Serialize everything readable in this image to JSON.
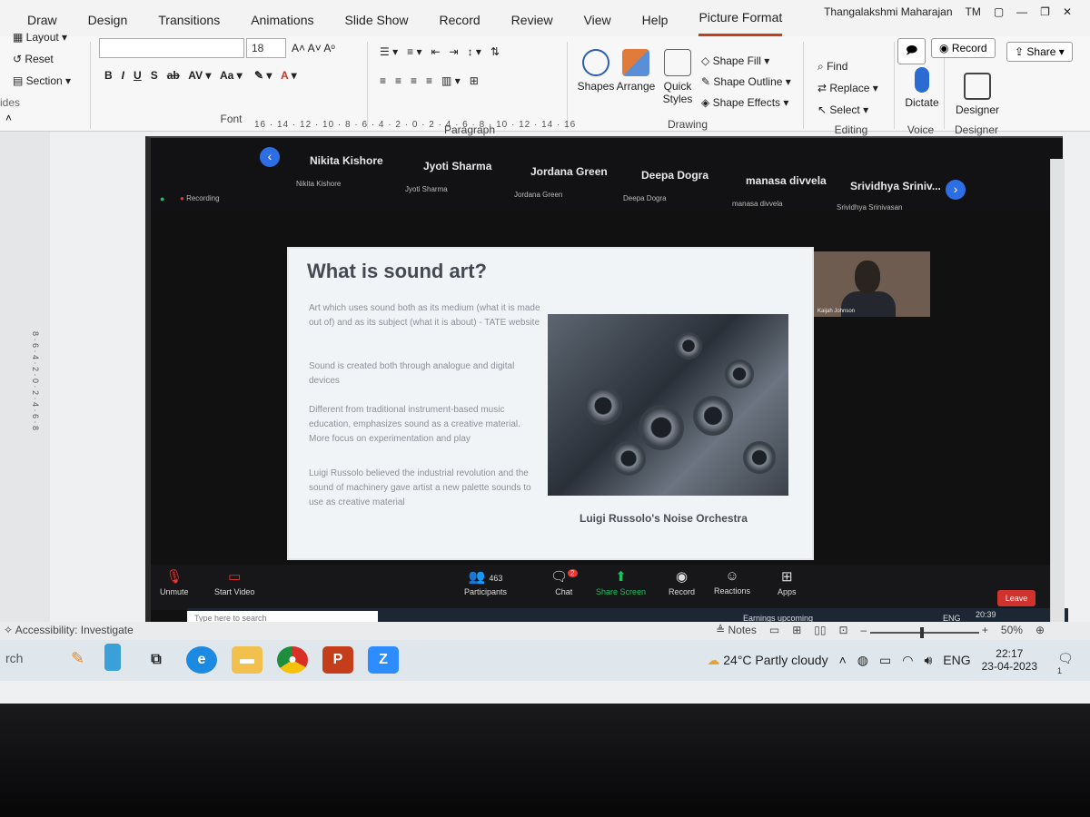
{
  "ribbon": {
    "tabs": [
      "Draw",
      "Design",
      "Transitions",
      "Animations",
      "Slide Show",
      "Record",
      "Review",
      "View",
      "Help",
      "Picture Format"
    ],
    "user_name": "Thangalakshmi Maharajan",
    "user_initials": "TM",
    "record_button": "Record",
    "share_button": "Share",
    "slides": {
      "layout": "Layout",
      "reset": "Reset",
      "section": "Section",
      "label": "ides"
    },
    "font": {
      "size": "18",
      "label": "Font"
    },
    "paragraph_label": "Paragraph",
    "drawing": {
      "shapes": "Shapes",
      "arrange": "Arrange",
      "quick_styles": "Quick Styles",
      "shape_fill": "Shape Fill",
      "shape_outline": "Shape Outline",
      "shape_effects": "Shape Effects",
      "label": "Drawing"
    },
    "editing": {
      "find": "Find",
      "replace": "Replace",
      "select": "Select",
      "label": "Editing"
    },
    "voice": {
      "dictate": "Dictate",
      "label": "Voice"
    },
    "designer": {
      "button": "Designer",
      "label": "Designer"
    },
    "ruler_text": "16 · 14 · 12 · 10 · 8 · 6 · 4 · 2 · 0 · 2 · 4 · 6 · 8 · 10 · 12 · 14 · 16"
  },
  "zoom": {
    "participants_top": [
      {
        "name": "Nikita Kishore",
        "sub": "Nikita Kishore"
      },
      {
        "name": "Jyoti Sharma",
        "sub": "Jyoti Sharma"
      },
      {
        "name": "Jordana Green",
        "sub": "Jordana Green"
      },
      {
        "name": "Deepa Dogra",
        "sub": "Deepa Dogra"
      },
      {
        "name": "manasa divvela",
        "sub": "manasa divvela"
      },
      {
        "name": "Srividhya Sriniv...",
        "sub": "Srividhya Srinivasan"
      }
    ],
    "recording_label": "Recording",
    "video_tile_name": "Kaijah Johnson",
    "toolbar": {
      "unmute": "Unmute",
      "start_video": "Start Video",
      "participants": "Participants",
      "participants_count": "463",
      "chat": "Chat",
      "chat_badge": "2",
      "share_screen": "Share Screen",
      "record": "Record",
      "reactions": "Reactions",
      "apps": "Apps",
      "leave": "Leave"
    },
    "inner_taskbar": {
      "search_placeholder": "Type here to search",
      "news": "Earnings upcoming",
      "lang": "ENG",
      "time": "20:39"
    }
  },
  "slide": {
    "title": "What is sound art?",
    "paragraphs": [
      "Art which uses sound both as its medium (what it is made out of) and as its subject (what it is about) - TATE website",
      "Sound is created both through analogue and digital devices",
      "Different from traditional instrument-based music education, emphasizes sound as a creative material. More focus on experimentation and play",
      "Luigi Russolo believed the industrial revolution and the sound of machinery gave artist a new palette sounds to use as creative material"
    ],
    "caption": "Luigi Russolo's Noise Orchestra"
  },
  "statusbar": {
    "accessibility": "Accessibility: Investigate",
    "notes": "Notes",
    "zoom_level": "50%"
  },
  "taskbar": {
    "search_text": "rch",
    "weather": "24°C  Partly cloudy",
    "lang": "ENG",
    "time": "22:17",
    "date": "23-04-2023",
    "notif_count": "1"
  },
  "colors": {
    "accent": "#c43e1c",
    "zoom_blue": "#2d6ee5",
    "leave_red": "#d0322d",
    "share_green": "#1fbf5f"
  }
}
